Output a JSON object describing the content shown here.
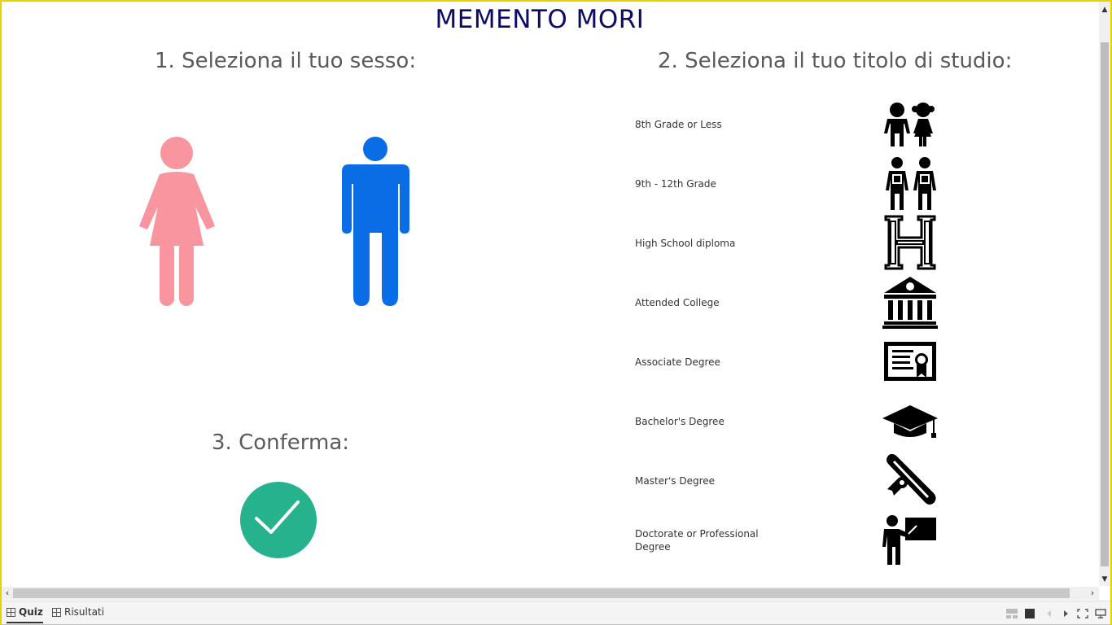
{
  "title": "MEMENTO MORI",
  "section1": {
    "heading": "1. Seleziona il tuo sesso:",
    "options": [
      "female-icon",
      "male-icon"
    ]
  },
  "section2": {
    "heading": "2. Seleziona il tuo titolo di studio:",
    "items": [
      {
        "label": "8th Grade or Less",
        "icon": "children-icon"
      },
      {
        "label": "9th - 12th Grade",
        "icon": "students-backpack-icon"
      },
      {
        "label": "High School diploma",
        "icon": "letter-h-icon"
      },
      {
        "label": "Attended College",
        "icon": "university-building-icon"
      },
      {
        "label": "Associate Degree",
        "icon": "certificate-icon"
      },
      {
        "label": "Bachelor's Degree",
        "icon": "graduation-cap-icon"
      },
      {
        "label": "Master's Degree",
        "icon": "diploma-scroll-icon"
      },
      {
        "label": "Doctorate or Professional Degree",
        "icon": "teacher-icon"
      }
    ]
  },
  "section3": {
    "heading": "3. Conferma:",
    "icon": "checkmark-icon"
  },
  "tabs": [
    {
      "label": "Quiz",
      "active": true
    },
    {
      "label": "Risultati",
      "active": false
    }
  ],
  "colors": {
    "title": "#0d0b66",
    "female": "#f9959e",
    "male": "#0a6de6",
    "confirm": "#26b28c",
    "frame": "#e8d100"
  }
}
